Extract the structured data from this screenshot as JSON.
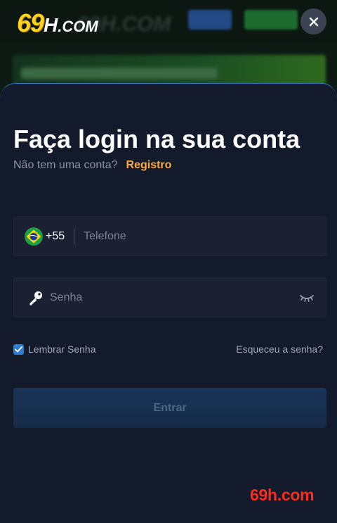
{
  "brand": {
    "logo_number": "69",
    "logo_h": "H",
    "logo_domain": ".COM",
    "watermark": "69h.com",
    "colors": {
      "logo_yellow": "#ffd21f",
      "accent_orange": "#ffab3a",
      "sheet_bg": "#131a2b",
      "watermark_red": "#ff2a1a"
    }
  },
  "modal": {
    "close_icon": "close-icon",
    "title": "Faça login na sua conta",
    "no_account_text": "Não tem uma conta?",
    "register_link": "Registro"
  },
  "form": {
    "phone": {
      "flag_icon": "brazil-flag-icon",
      "country_code": "+55",
      "placeholder": "Telefone",
      "value": ""
    },
    "password": {
      "key_icon": "key-icon",
      "placeholder": "Senha",
      "value": "",
      "toggle_icon": "eye-closed-icon"
    },
    "remember_label": "Lembrar Senha",
    "remember_checked": true,
    "forgot_link": "Esqueceu a senha?",
    "submit_label": "Entrar"
  }
}
